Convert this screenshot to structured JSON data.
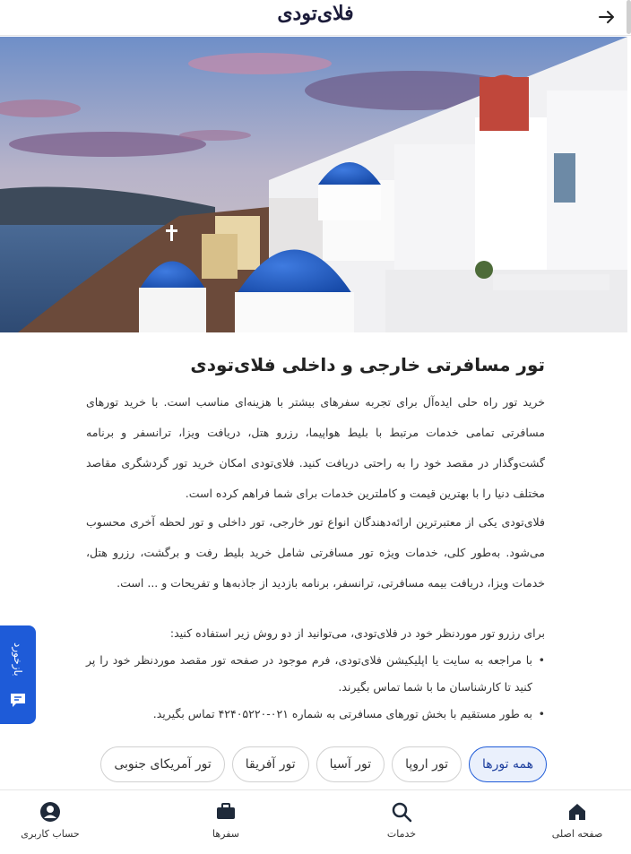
{
  "header": {
    "logo": "فلای‌تودی",
    "back_icon": "arrow-right-icon"
  },
  "hero": {
    "alt": "santorini-illustration"
  },
  "article": {
    "title": "تور مسافرتی خارجی و داخلی فلای‌تودی",
    "p1": "خرید تور راه حلی ایده‌آل برای تجربه سفرهای بیشتر با هزینه‌ای مناسب است. با خرید تورهای مسافرتی تمامی خدمات مرتبط با بلیط هواپیما، رزرو هتل، دریافت ویزا، ترانسفر و برنامه گشت‌وگذار در مقصد خود را به راحتی دریافت کنید. فلای‌تودی امکان خرید تور گردشگری مقاصد مختلف دنیا را با بهترین قیمت و کاملترین خدمات برای شما فراهم کرده است.",
    "p2": "فلای‌تودی یکی از معتبرترین ارائه‌دهندگان انواع تور خارجی، تور داخلی و تور لحظه آخری محسوب می‌شود. به‌طور کلی، خدمات ویژه تور مسافرتی شامل خرید بلیط رفت و برگشت، رزرو هتل، خدمات ویزا، دریافت بیمه مسافرتی، ترانسفر، برنامه بازدید از جاذبه‌ها و تفریحات و ... است.",
    "p3": "برای رزرو تور موردنظر خود در فلای‌تودی، می‌توانید از دو روش زیر استفاده کنید:",
    "bullets": [
      "با مراجعه به سایت یا اپلیکیشن فلای‌تودی، فرم موجود در صفحه تور مقصد موردنظر خود را پر کنید تا کارشناسان ما با شما تماس بگیرند.",
      "به طور مستقیم با بخش تورهای مسافرتی به شماره ۰۲۱-۴۲۴۰۵۲۲۰ تماس بگیرید."
    ]
  },
  "feedback": {
    "label": "بازخورد",
    "icon": "feedback-icon"
  },
  "chips": [
    "همه تورها",
    "تور اروپا",
    "تور آسیا",
    "تور آفریقا",
    "تور آمریکای جنوبی"
  ],
  "active_chip": 0,
  "bottom_nav": [
    {
      "label": "صفحه اصلی",
      "icon": "home-icon"
    },
    {
      "label": "خدمات",
      "icon": "search-icon"
    },
    {
      "label": "سفرها",
      "icon": "briefcase-icon"
    },
    {
      "label": "حساب کاربری",
      "icon": "account-icon"
    }
  ],
  "colors": {
    "accent": "#1e5bd8",
    "chip_active_bg": "#eaf0fc",
    "text": "#333333"
  }
}
